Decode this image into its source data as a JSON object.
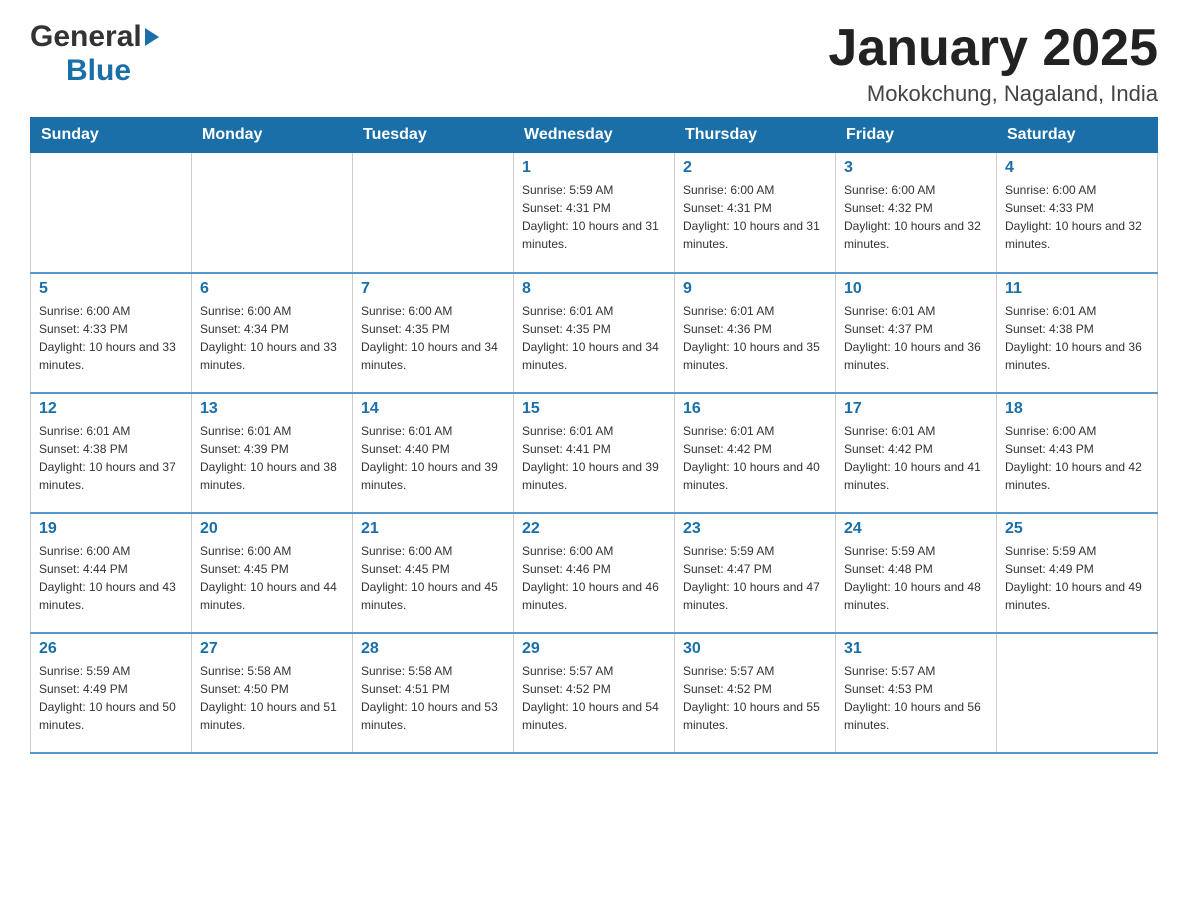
{
  "header": {
    "logo_general": "General",
    "logo_blue": "Blue",
    "title": "January 2025",
    "subtitle": "Mokokchung, Nagaland, India"
  },
  "calendar": {
    "days_of_week": [
      "Sunday",
      "Monday",
      "Tuesday",
      "Wednesday",
      "Thursday",
      "Friday",
      "Saturday"
    ],
    "weeks": [
      [
        {
          "day": "",
          "info": ""
        },
        {
          "day": "",
          "info": ""
        },
        {
          "day": "",
          "info": ""
        },
        {
          "day": "1",
          "info": "Sunrise: 5:59 AM\nSunset: 4:31 PM\nDaylight: 10 hours and 31 minutes."
        },
        {
          "day": "2",
          "info": "Sunrise: 6:00 AM\nSunset: 4:31 PM\nDaylight: 10 hours and 31 minutes."
        },
        {
          "day": "3",
          "info": "Sunrise: 6:00 AM\nSunset: 4:32 PM\nDaylight: 10 hours and 32 minutes."
        },
        {
          "day": "4",
          "info": "Sunrise: 6:00 AM\nSunset: 4:33 PM\nDaylight: 10 hours and 32 minutes."
        }
      ],
      [
        {
          "day": "5",
          "info": "Sunrise: 6:00 AM\nSunset: 4:33 PM\nDaylight: 10 hours and 33 minutes."
        },
        {
          "day": "6",
          "info": "Sunrise: 6:00 AM\nSunset: 4:34 PM\nDaylight: 10 hours and 33 minutes."
        },
        {
          "day": "7",
          "info": "Sunrise: 6:00 AM\nSunset: 4:35 PM\nDaylight: 10 hours and 34 minutes."
        },
        {
          "day": "8",
          "info": "Sunrise: 6:01 AM\nSunset: 4:35 PM\nDaylight: 10 hours and 34 minutes."
        },
        {
          "day": "9",
          "info": "Sunrise: 6:01 AM\nSunset: 4:36 PM\nDaylight: 10 hours and 35 minutes."
        },
        {
          "day": "10",
          "info": "Sunrise: 6:01 AM\nSunset: 4:37 PM\nDaylight: 10 hours and 36 minutes."
        },
        {
          "day": "11",
          "info": "Sunrise: 6:01 AM\nSunset: 4:38 PM\nDaylight: 10 hours and 36 minutes."
        }
      ],
      [
        {
          "day": "12",
          "info": "Sunrise: 6:01 AM\nSunset: 4:38 PM\nDaylight: 10 hours and 37 minutes."
        },
        {
          "day": "13",
          "info": "Sunrise: 6:01 AM\nSunset: 4:39 PM\nDaylight: 10 hours and 38 minutes."
        },
        {
          "day": "14",
          "info": "Sunrise: 6:01 AM\nSunset: 4:40 PM\nDaylight: 10 hours and 39 minutes."
        },
        {
          "day": "15",
          "info": "Sunrise: 6:01 AM\nSunset: 4:41 PM\nDaylight: 10 hours and 39 minutes."
        },
        {
          "day": "16",
          "info": "Sunrise: 6:01 AM\nSunset: 4:42 PM\nDaylight: 10 hours and 40 minutes."
        },
        {
          "day": "17",
          "info": "Sunrise: 6:01 AM\nSunset: 4:42 PM\nDaylight: 10 hours and 41 minutes."
        },
        {
          "day": "18",
          "info": "Sunrise: 6:00 AM\nSunset: 4:43 PM\nDaylight: 10 hours and 42 minutes."
        }
      ],
      [
        {
          "day": "19",
          "info": "Sunrise: 6:00 AM\nSunset: 4:44 PM\nDaylight: 10 hours and 43 minutes."
        },
        {
          "day": "20",
          "info": "Sunrise: 6:00 AM\nSunset: 4:45 PM\nDaylight: 10 hours and 44 minutes."
        },
        {
          "day": "21",
          "info": "Sunrise: 6:00 AM\nSunset: 4:45 PM\nDaylight: 10 hours and 45 minutes."
        },
        {
          "day": "22",
          "info": "Sunrise: 6:00 AM\nSunset: 4:46 PM\nDaylight: 10 hours and 46 minutes."
        },
        {
          "day": "23",
          "info": "Sunrise: 5:59 AM\nSunset: 4:47 PM\nDaylight: 10 hours and 47 minutes."
        },
        {
          "day": "24",
          "info": "Sunrise: 5:59 AM\nSunset: 4:48 PM\nDaylight: 10 hours and 48 minutes."
        },
        {
          "day": "25",
          "info": "Sunrise: 5:59 AM\nSunset: 4:49 PM\nDaylight: 10 hours and 49 minutes."
        }
      ],
      [
        {
          "day": "26",
          "info": "Sunrise: 5:59 AM\nSunset: 4:49 PM\nDaylight: 10 hours and 50 minutes."
        },
        {
          "day": "27",
          "info": "Sunrise: 5:58 AM\nSunset: 4:50 PM\nDaylight: 10 hours and 51 minutes."
        },
        {
          "day": "28",
          "info": "Sunrise: 5:58 AM\nSunset: 4:51 PM\nDaylight: 10 hours and 53 minutes."
        },
        {
          "day": "29",
          "info": "Sunrise: 5:57 AM\nSunset: 4:52 PM\nDaylight: 10 hours and 54 minutes."
        },
        {
          "day": "30",
          "info": "Sunrise: 5:57 AM\nSunset: 4:52 PM\nDaylight: 10 hours and 55 minutes."
        },
        {
          "day": "31",
          "info": "Sunrise: 5:57 AM\nSunset: 4:53 PM\nDaylight: 10 hours and 56 minutes."
        },
        {
          "day": "",
          "info": ""
        }
      ]
    ]
  }
}
